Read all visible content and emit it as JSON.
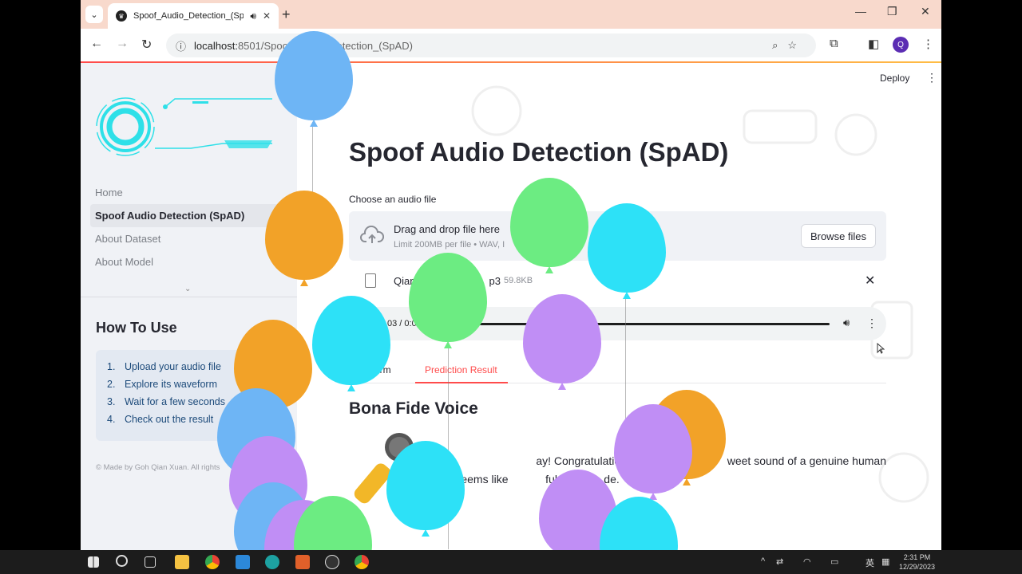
{
  "browser": {
    "tab_title": "Spoof_Audio_Detection_(SpAD)",
    "url_host": "localhost:",
    "url_path": "8501/Spoof_Audio_Detection_(SpAD)",
    "profile_initial": "Q"
  },
  "sidebar": {
    "nav": [
      "Home",
      "Spoof Audio Detection (SpAD)",
      "About Dataset",
      "About Model"
    ],
    "active_index": 1,
    "howto_title": "How To Use",
    "steps": [
      {
        "n": "1.",
        "text": "Upload your audio file"
      },
      {
        "n": "2.",
        "text": "Explore its waveform"
      },
      {
        "n": "3.",
        "text": "Wait for a few seconds"
      },
      {
        "n": "4.",
        "text": "Check out the result"
      }
    ],
    "footer": "© Made by Goh Qian Xuan. All rights"
  },
  "header": {
    "deploy": "Deploy"
  },
  "main": {
    "title": "Spoof Audio Detection (SpAD)",
    "uploader_label": "Choose an audio file",
    "drop_text": "Drag and drop file here",
    "drop_limit": "Limit 200MB per file • WAV, I",
    "browse": "Browse files",
    "file_name": "Qian",
    "file_ext": "p3",
    "file_size": "59.8KB",
    "audio_time": "03 / 0:0",
    "tabs": [
      "eform",
      "Prediction Result"
    ],
    "result_title": "Bona Fide Voice",
    "result_line1": "ay! Congratulations! This audi              weet sound of a genuine human",
    "result_line2": "ice. It seems like            ful h            de."
  },
  "colors": {
    "accent": "#ff4b4b",
    "blue": "#6eb5f5",
    "orange": "#f2a228",
    "green": "#6cec82",
    "cyan": "#2de1f7",
    "purple": "#c08ef5"
  },
  "taskbar": {
    "time": "2:31 PM",
    "date": "12/29/2023",
    "lang": "英"
  }
}
